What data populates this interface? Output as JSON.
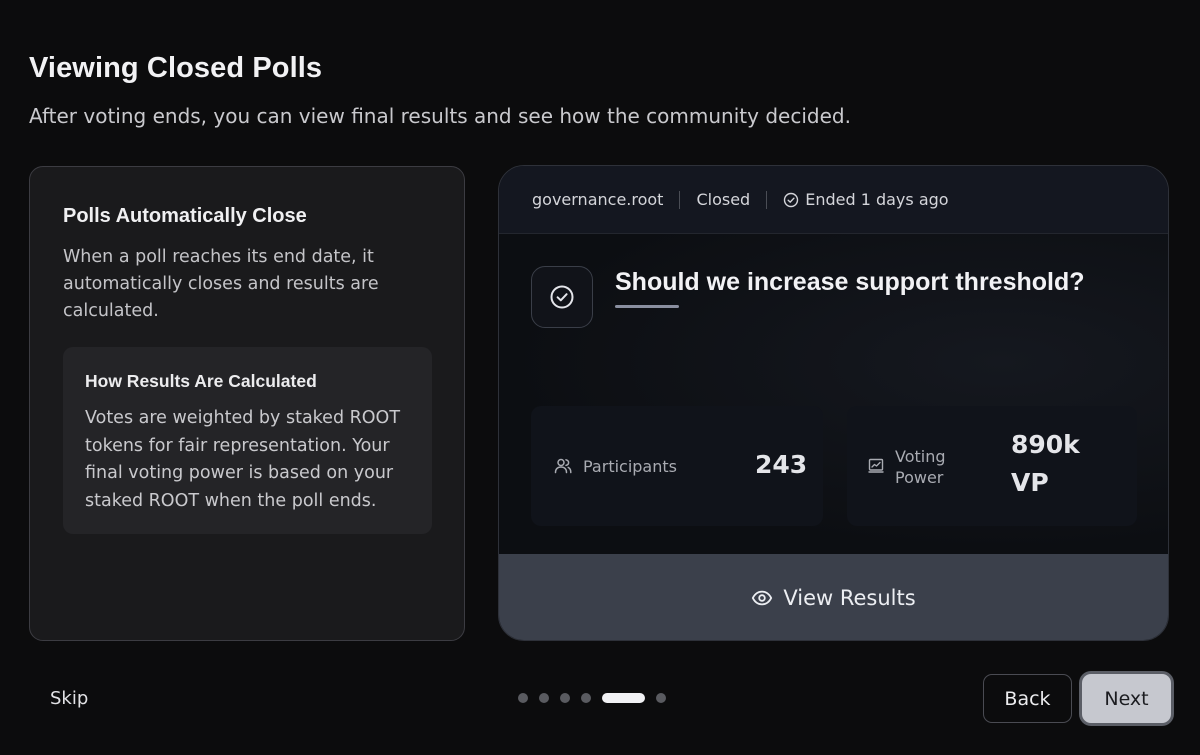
{
  "page": {
    "title": "Viewing Closed Polls",
    "subtitle": "After voting ends, you can view final results and see how the community decided."
  },
  "info_card": {
    "heading": "Polls Automatically Close",
    "text": "When a poll reaches its end date, it automatically closes and results are calculated.",
    "calc_heading": "How Results Are Calculated",
    "calc_text": "Votes are weighted by staked ROOT tokens for fair representation. Your final voting power is based on your staked ROOT when the poll ends."
  },
  "poll": {
    "space": "governance.root",
    "status": "Closed",
    "ended": "Ended 1 days ago",
    "question": "Should we increase support threshold?",
    "stats": [
      {
        "label": "Participants",
        "value": "243",
        "icon": "users-icon"
      },
      {
        "label": "Voting Power",
        "value": "890k VP",
        "icon": "chart-icon"
      }
    ],
    "view_results_label": "View Results"
  },
  "footer": {
    "skip_label": "Skip",
    "back_label": "Back",
    "next_label": "Next",
    "steps_total": 6,
    "active_step": 5
  },
  "colors": {
    "background": "#0c0c0d",
    "card": "#1a1a1c",
    "view_results_bg": "#3b404b",
    "next_button_bg": "#c6c8cf"
  }
}
